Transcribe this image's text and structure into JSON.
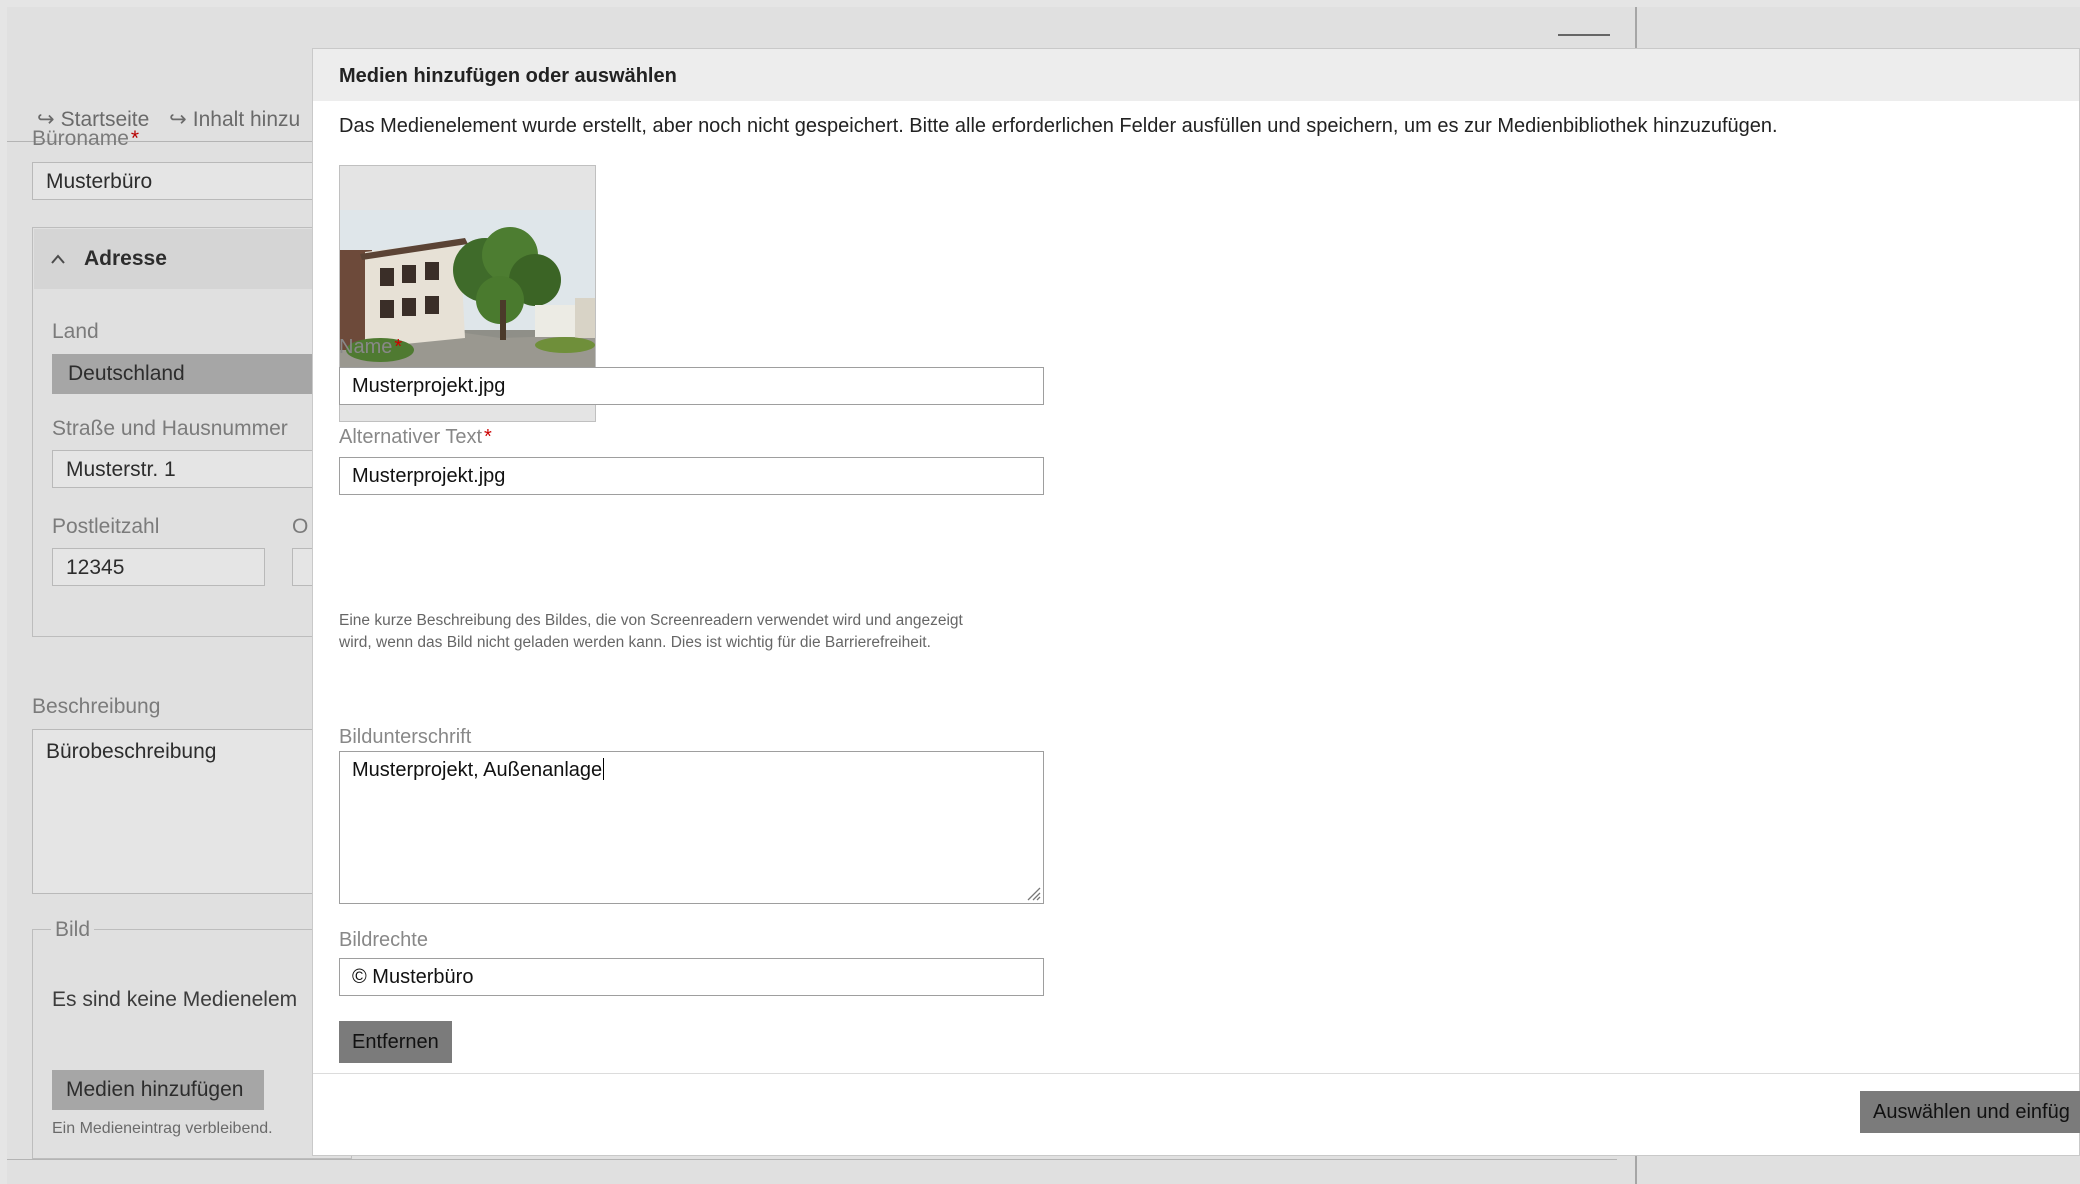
{
  "background_page": {
    "breadcrumb": [
      {
        "arrow": "↪",
        "label": "Startseite"
      },
      {
        "arrow": "↪",
        "label": "Inhalt hinzu"
      }
    ],
    "office_name": {
      "label": "Büroname",
      "required_mark": "*",
      "value": "Musterbüro"
    },
    "address": {
      "heading": "Adresse",
      "chevron": "^",
      "country": {
        "label": "Land",
        "value": "Deutschland"
      },
      "street": {
        "label": "Straße und Hausnummer",
        "value": "Musterstr. 1"
      },
      "postal_code": {
        "label": "Postleitzahl",
        "value": "12345"
      },
      "city_label_partial": "O"
    },
    "description": {
      "label": "Beschreibung",
      "value": "Bürobeschreibung"
    },
    "image": {
      "legend": "Bild",
      "empty_text": "Es sind keine Medienelem",
      "add_media_button": "Medien hinzufügen",
      "remaining_note": "Ein Medieneintrag verbleibend."
    }
  },
  "dialog": {
    "title": "Medien hinzufügen oder auswählen",
    "notice": "Das Medienelement wurde erstellt, aber noch nicht gespeichert. Bitte alle erforderlichen Felder ausfüllen und speichern, um es zur Medienbibliothek hinzuzufügen.",
    "thumbnail": {
      "icon": "building-photo"
    },
    "name": {
      "label": "Name",
      "required_mark": "*",
      "value": "Musterprojekt.jpg"
    },
    "alt_text": {
      "label": "Alternativer Text",
      "required_mark": "*",
      "value": "Musterprojekt.jpg",
      "help": "Eine kurze Beschreibung des Bildes, die von Screenreadern verwendet wird und angezeigt wird, wenn das Bild nicht geladen werden kann. Dies ist wichtig für die Barrierefreiheit."
    },
    "caption": {
      "label": "Bildunterschrift",
      "value": "Musterprojekt, Außenanlage"
    },
    "rights": {
      "label": "Bildrechte",
      "value": "© Musterbüro"
    },
    "remove_button": "Entfernen",
    "select_insert_button": "Auswählen und einfüg"
  },
  "colors": {
    "required": "#cc0000",
    "button_gray": "#7b7b7b",
    "titlebar": "#ededed"
  }
}
